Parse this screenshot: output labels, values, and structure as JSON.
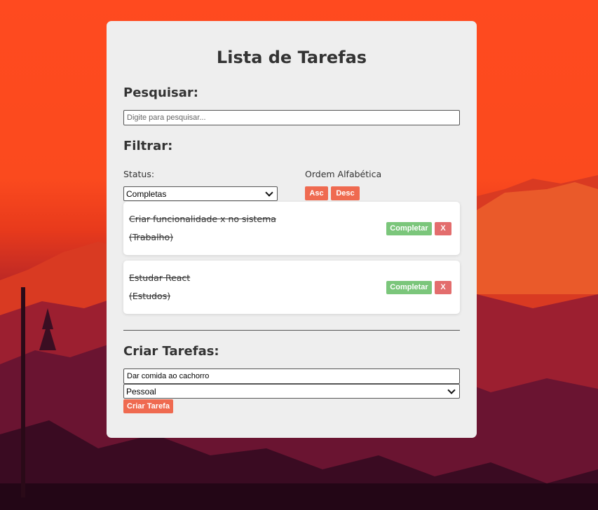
{
  "app": {
    "title": "Lista de Tarefas"
  },
  "search": {
    "heading": "Pesquisar:",
    "placeholder": "Digite para pesquisar...",
    "value": ""
  },
  "filter": {
    "heading": "Filtrar:",
    "status_label": "Status:",
    "status_selected": "Completas",
    "sort_label": "Ordem Alfabética",
    "asc_label": "Asc",
    "desc_label": "Desc"
  },
  "tasks": [
    {
      "name": "Criar funcionalidade x no sistema",
      "category": "(Trabalho)",
      "complete_label": "Completar",
      "delete_label": "X",
      "completed": true
    },
    {
      "name": "Estudar React",
      "category": "(Estudos)",
      "complete_label": "Completar",
      "delete_label": "X",
      "completed": true
    }
  ],
  "create": {
    "heading": "Criar Tarefas:",
    "input_value": "Dar comida ao cachorro",
    "category_selected": "Pessoal",
    "button_label": "Criar Tarefa"
  },
  "colors": {
    "accent": "#ef6a50",
    "complete": "#7bc67b",
    "delete": "#e36d6d",
    "card_bg": "#eeeeee",
    "text": "#333333"
  }
}
